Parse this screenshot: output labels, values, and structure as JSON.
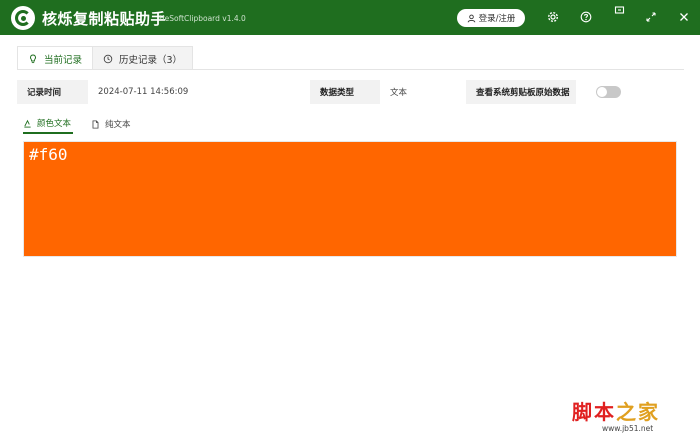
{
  "app": {
    "title": "核烁复制粘贴助手",
    "version": "HeSoftClipboard v1.4.0",
    "login_label": "登录/注册"
  },
  "colors": {
    "brand": "#1f6e1f",
    "preview": "#ff6600"
  },
  "titlebar_icons": [
    "settings-icon",
    "help-icon",
    "mini-window-icon",
    "maximize-icon",
    "close-icon"
  ],
  "main_tabs": [
    {
      "label": "当前记录",
      "icon": "bulb-icon",
      "active": true
    },
    {
      "label": "历史记录（3）",
      "icon": "history-icon",
      "active": false
    }
  ],
  "record": {
    "time_label": "记录时间",
    "time_value": "2024-07-11 14:56:09",
    "type_label": "数据类型",
    "type_value": "文本",
    "raw_label": "查看系统剪贴板原始数据",
    "raw_toggle_on": false
  },
  "sub_tabs": [
    {
      "label": "颜色文本",
      "icon": "palette-icon",
      "active": true
    },
    {
      "label": "纯文本",
      "icon": "file-icon",
      "active": false
    }
  ],
  "preview": {
    "text": "#f60"
  },
  "watermark": {
    "part1": "脚本",
    "part2": "之家",
    "url": "www.jb51.net"
  }
}
